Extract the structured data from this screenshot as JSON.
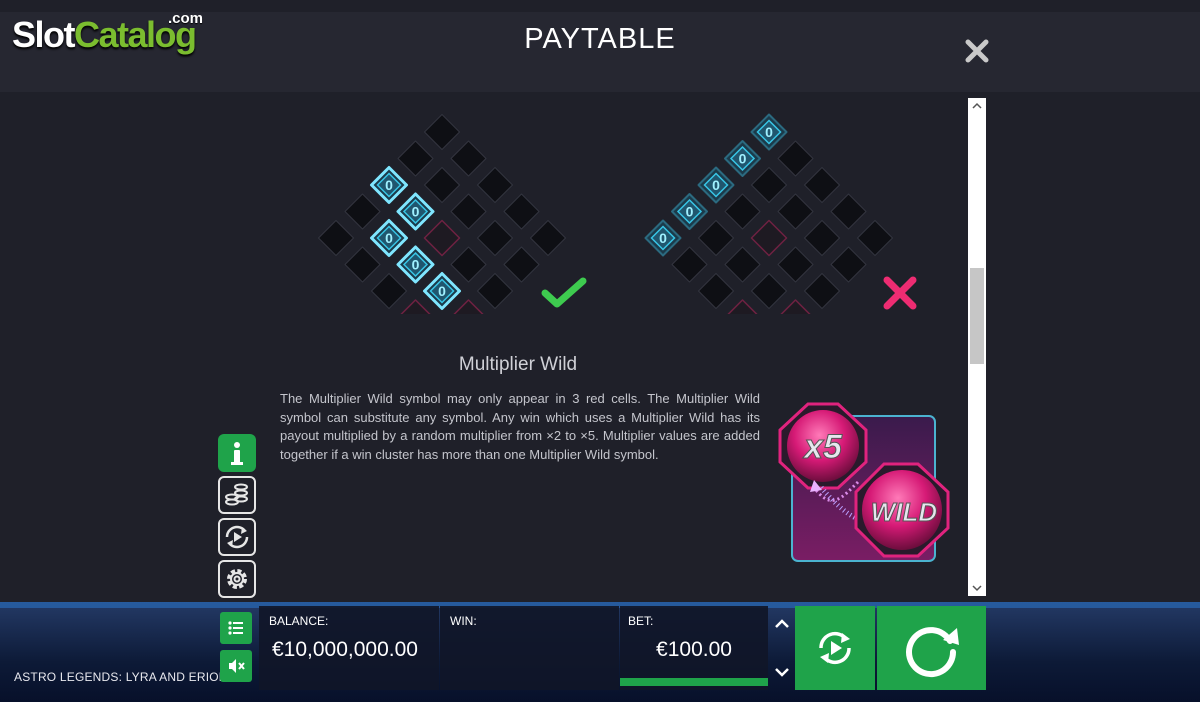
{
  "brand": {
    "slot": "Slot",
    "catalog": "Catalog",
    "com": ".com"
  },
  "header": {
    "title": "PAYTABLE"
  },
  "icons": {
    "close": "close-icon",
    "info": "info-icon",
    "paytable": "coins-stack-icon",
    "autoplay": "autoplay-icon",
    "settings": "gear-icon",
    "menu": "list-icon",
    "sound": "sound-muted-icon",
    "spin": "spin-icon"
  },
  "content": {
    "symbol_glyph": "0",
    "heading": "Multiplier Wild",
    "description": "The Multiplier Wild symbol may only appear in 3 red cells. The Multiplier Wild symbol can substitute any symbol. Any win which uses a Multiplier Wild has its payout multiplied by a random multiplier from ×2 to ×5. Multiplier values are added together if a win cluster has more than one Multiplier Wild symbol.",
    "multiplier_label": "x5",
    "wild_label": "WILD"
  },
  "status": {
    "valid_example": "check-icon",
    "invalid_example": "cross-icon"
  },
  "bottom": {
    "game_name": "ASTRO LEGENDS: LYRA AND ERION",
    "balance_label": "BALANCE:",
    "balance_value": "€10,000,000.00",
    "win_label": "WIN:",
    "win_value": "",
    "bet_label": "BET:",
    "bet_value": "€100.00"
  },
  "colors": {
    "accent_green": "#1fa34a",
    "symbol_cyan": "#38c5e6",
    "red_cell": "#b0245a",
    "wild_pink": "#e0237e",
    "check_green": "#3ecb4f",
    "cross_pink": "#ee2c72"
  }
}
